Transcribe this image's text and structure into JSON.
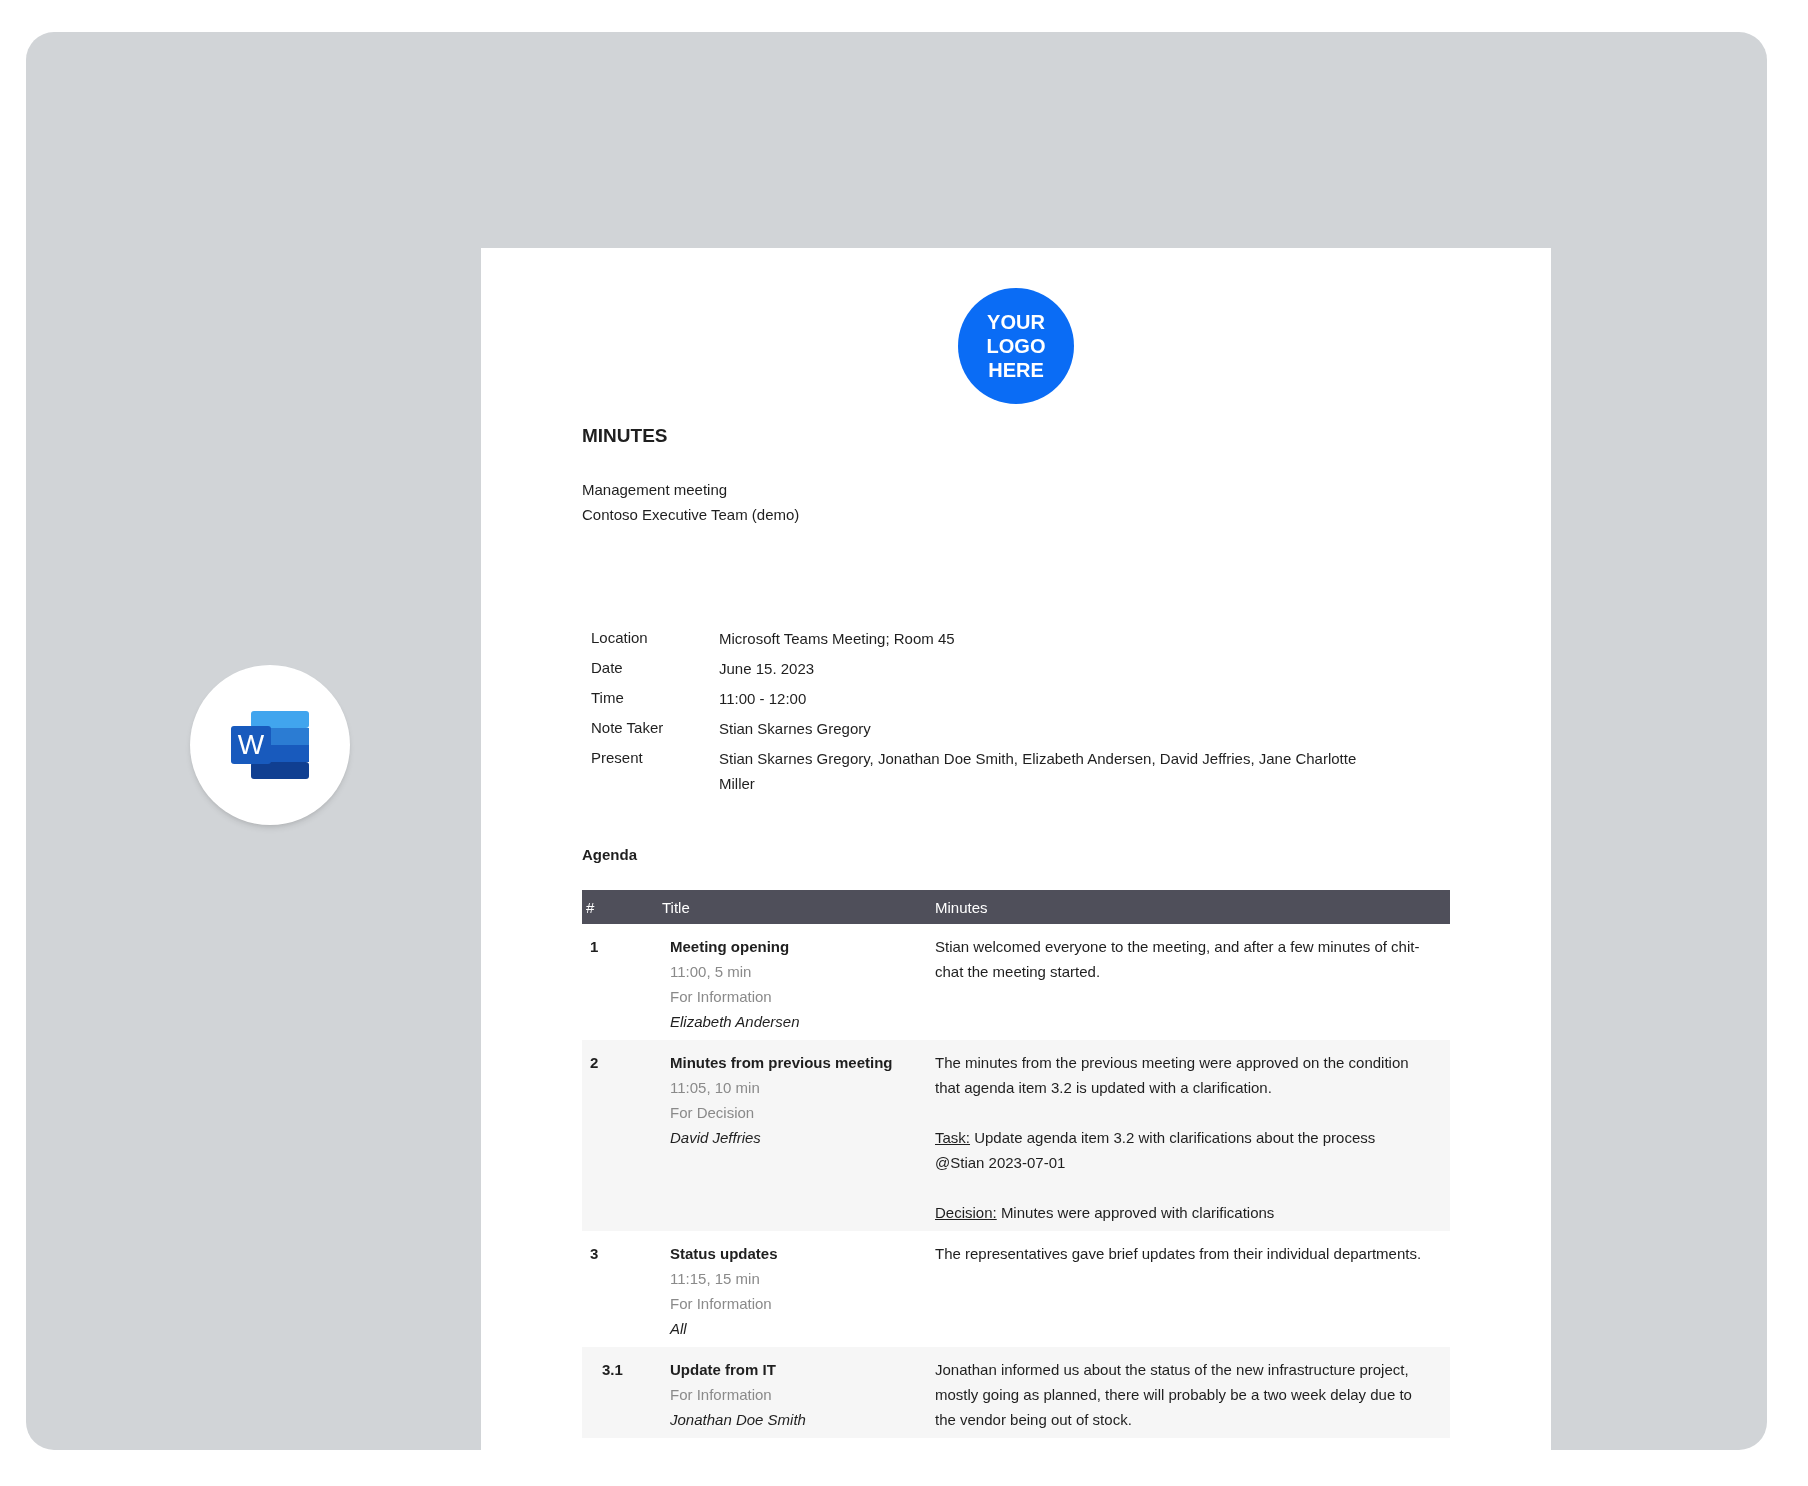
{
  "app_badge": {
    "letter": "W"
  },
  "document": {
    "logo": [
      "YOUR",
      "LOGO",
      "HERE"
    ],
    "title": "MINUTES",
    "subtitle": [
      "Management meeting",
      "Contoso Executive Team (demo)"
    ],
    "details": [
      {
        "label": "Location",
        "value": "Microsoft Teams Meeting; Room 45"
      },
      {
        "label": "Date",
        "value": "June 15. 2023"
      },
      {
        "label": "Time",
        "value": "11:00 - 12:00"
      },
      {
        "label": "Note Taker",
        "value": "Stian Skarnes Gregory"
      },
      {
        "label": "Present",
        "value": "Stian Skarnes Gregory, Jonathan Doe Smith, Elizabeth Andersen, David Jeffries, Jane Charlotte Miller"
      }
    ],
    "agenda_heading": "Agenda",
    "agenda_columns": [
      "#",
      "Title",
      "Minutes"
    ],
    "agenda": [
      {
        "number": "1",
        "title": "Meeting opening",
        "time": "11:00, 5 min",
        "type": "For Information",
        "presenter": "Elizabeth Andersen",
        "minutes": [
          {
            "text": "Stian welcomed everyone to the meeting, and after a few minutes of chit-chat the meeting started."
          }
        ]
      },
      {
        "number": "2",
        "title": "Minutes from previous meeting",
        "time": "11:05, 10 min",
        "type": "For Decision",
        "presenter": "David Jeffries",
        "minutes": [
          {
            "text": "The minutes from the previous meeting were approved on the condition that agenda item 3.2 is updated with a clarification."
          },
          {
            "label": "Task:",
            "text": "Update agenda item 3.2 with clarifications about the process @Stian 2023-07-01"
          },
          {
            "label": "Decision:",
            "text": "Minutes were approved with clarifications"
          }
        ]
      },
      {
        "number": "3",
        "title": "Status updates",
        "time": "11:15, 15 min",
        "type": "For Information",
        "presenter": "All",
        "minutes": [
          {
            "text": "The representatives gave brief updates from their individual departments."
          }
        ],
        "children": [
          {
            "number": "3.1",
            "title": "Update from IT",
            "type": "For Information",
            "presenter": "Jonathan Doe Smith",
            "minutes": [
              {
                "text": "Jonathan informed us about the status of the new infrastructure project, mostly going as planned, there will probably be a two week delay due to the vendor being out of stock."
              }
            ]
          }
        ]
      }
    ]
  }
}
